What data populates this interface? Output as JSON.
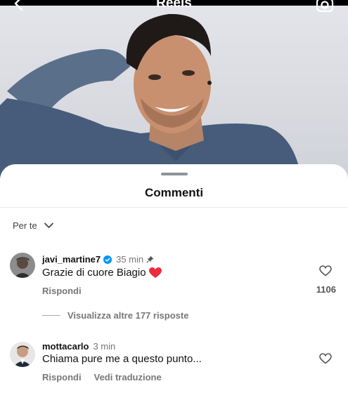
{
  "header": {
    "title": "Reels"
  },
  "comments_sheet": {
    "title": "Commenti",
    "sort_label": "Per te",
    "comments": [
      {
        "username": "javi_martine7",
        "verified": true,
        "time": "35 min",
        "pinned": true,
        "text": "Grazie di cuore Biagio",
        "emoji": "red-heart",
        "reply_label": "Rispondi",
        "like_count": "1106",
        "view_replies_label": "Visualizza altre 177 risposte"
      },
      {
        "username": "mottacarlo",
        "time": "3 min",
        "text": "Chiama pure me a questo punto...",
        "reply_label": "Rispondi",
        "translate_label": "Vedi traduzione"
      }
    ]
  },
  "colors": {
    "accent_blue": "#0095f6",
    "heart_red": "#ed2b3d"
  }
}
